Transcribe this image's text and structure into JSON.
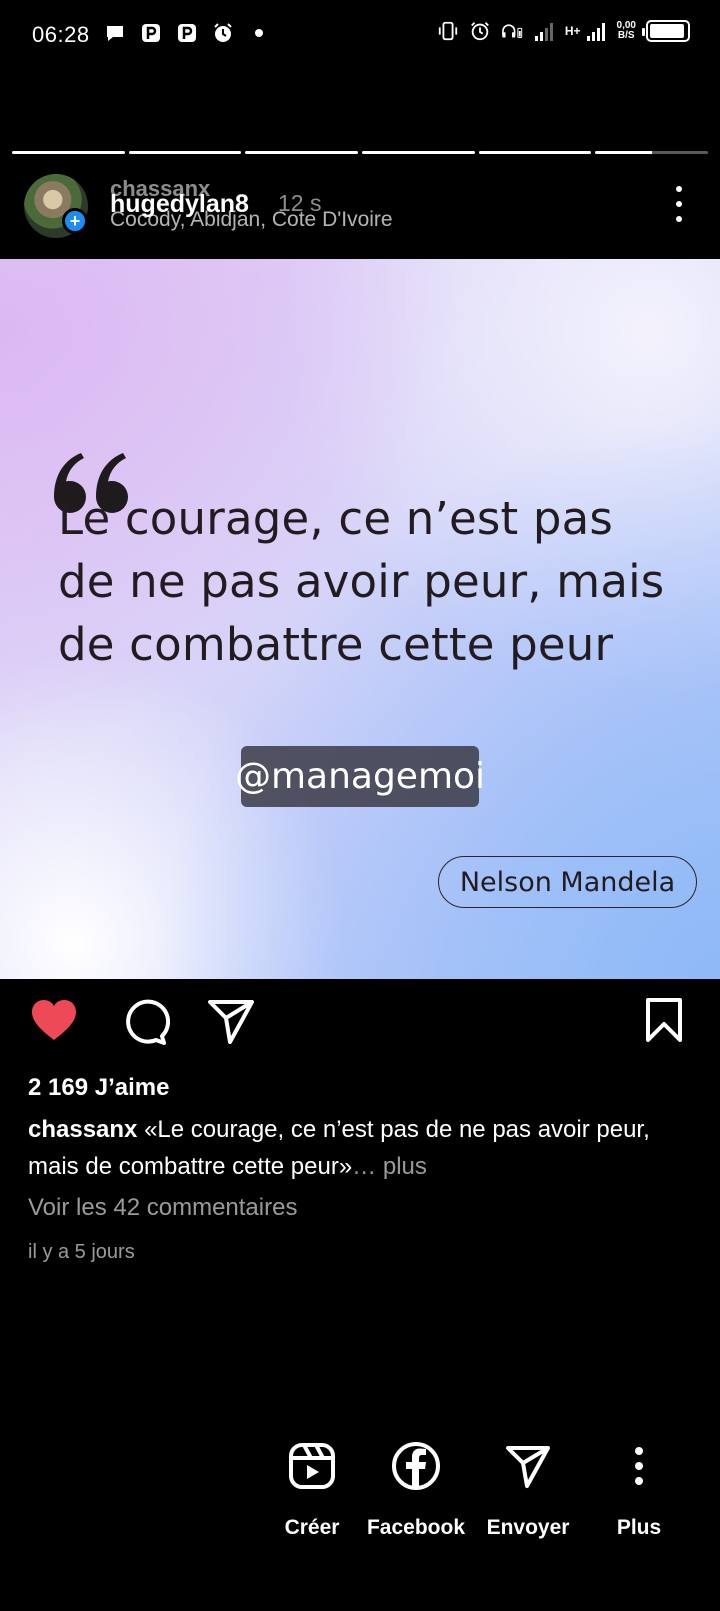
{
  "status_bar": {
    "time": "06:28",
    "speed_value": "0,00",
    "speed_unit": "B/S",
    "network_type": "H+",
    "battery_level": 0.95,
    "left_icons": [
      "message-icon",
      "parking-icon",
      "parking-icon",
      "alarm-icon",
      "dot-icon"
    ],
    "right_icons": [
      "vibrate-icon",
      "alarm-icon",
      "headset-icon",
      "signal-icon",
      "signal-icon",
      "battery-icon"
    ]
  },
  "story": {
    "segments_total": 6,
    "segments_done": 5,
    "current_segment_progress": 0.5
  },
  "header": {
    "username_overlay": "chassanx",
    "username": "hugedylan8",
    "time_ago": "12 s",
    "location": "Cocody, Abidjan, Cote D'Ivoire",
    "avatar_plus": "+"
  },
  "post": {
    "quote_mark": "66",
    "quote_text": "Le courage, ce n’est pas de ne pas avoir peur, mais de combattre cette peur",
    "mention": "@managemoi",
    "author": "Nelson Mandela",
    "colors": {
      "text": "#221c20",
      "gradient_left": "#dcb8f3",
      "gradient_right": "#8fb9f7"
    }
  },
  "actions": {
    "liked": true,
    "like_color": "#ed4956",
    "like_count": "2 169 J’aime",
    "caption_user": "chassanx",
    "caption_text": "«Le courage, ce n’est pas de ne pas avoir peur, mais de combattre cette peur»",
    "caption_more": "… plus",
    "comments_link": "Voir les 42 commentaires",
    "posted": "il y a 5 jours"
  },
  "share_bar": {
    "items": [
      {
        "label": "Créer",
        "icon": "reels-icon"
      },
      {
        "label": "Facebook",
        "icon": "facebook-icon"
      },
      {
        "label": "Envoyer",
        "icon": "send-icon"
      },
      {
        "label": "Plus",
        "icon": "more-icon"
      }
    ]
  }
}
